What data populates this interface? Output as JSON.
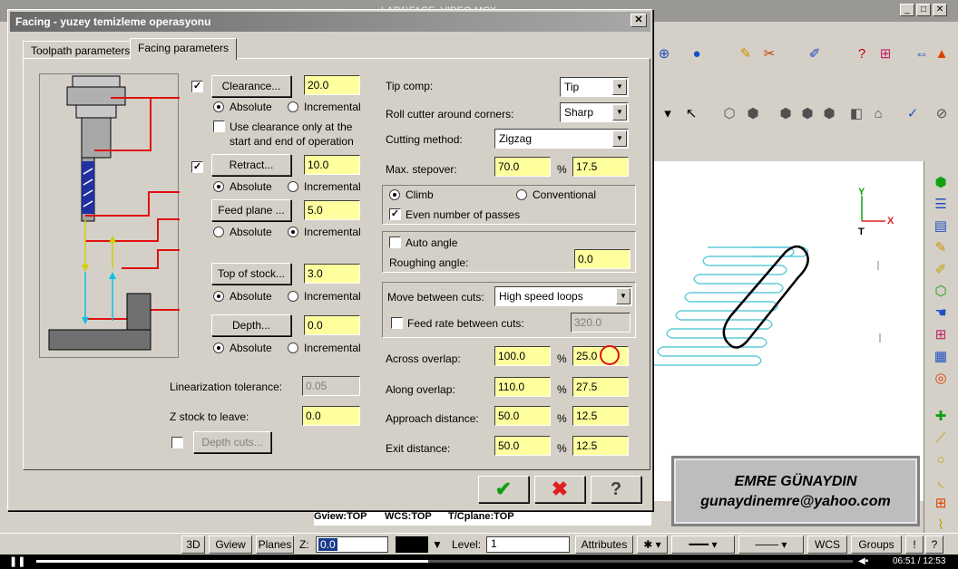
{
  "app": {
    "title_fragment": "                                                                                    LAR1\\FACE_VIDEO.MCX"
  },
  "dialog": {
    "title": "Facing - yuzey temizleme operasyonu",
    "tabs": [
      "Toolpath parameters",
      "Facing parameters"
    ],
    "clearance": {
      "label": "Clearance...",
      "value": "20.0",
      "checked": true,
      "mode": "Absolute",
      "note": "Use clearance only at the start and end of operation"
    },
    "retract": {
      "label": "Retract...",
      "value": "10.0",
      "checked": true,
      "mode": "Absolute"
    },
    "feed_plane": {
      "label": "Feed plane ...",
      "value": "5.0",
      "mode": "Incremental"
    },
    "top_of_stock": {
      "label": "Top of stock...",
      "value": "3.0",
      "mode": "Absolute"
    },
    "depth": {
      "label": "Depth...",
      "value": "0.0",
      "mode": "Absolute"
    },
    "radio_labels": {
      "absolute": "Absolute",
      "incremental": "Incremental"
    },
    "linearization": {
      "label": "Linearization tolerance:",
      "value": "0.05"
    },
    "z_stock": {
      "label": "Z stock to leave:",
      "value": "0.0"
    },
    "depth_cuts": {
      "label": "Depth cuts..."
    },
    "tip_comp": {
      "label": "Tip comp:",
      "value": "Tip"
    },
    "roll_cutter": {
      "label": "Roll cutter around corners:",
      "value": "Sharp"
    },
    "cutting_method": {
      "label": "Cutting method:",
      "value": "Zigzag"
    },
    "max_stepover": {
      "label": "Max. stepover:",
      "percent": "70.0",
      "value": "17.5"
    },
    "climb": "Climb",
    "conventional": "Conventional",
    "even_passes": "Even number of passes",
    "auto_angle": "Auto angle",
    "roughing_angle": {
      "label": "Roughing angle:",
      "value": "0.0"
    },
    "move_between": {
      "label": "Move between cuts:",
      "value": "High speed loops"
    },
    "feed_between": {
      "label": "Feed rate between cuts:",
      "value": "320.0"
    },
    "across_overlap": {
      "label": "Across overlap:",
      "percent": "100.0",
      "value": "25.0"
    },
    "along_overlap": {
      "label": "Along overlap:",
      "percent": "110.0",
      "value": "27.5"
    },
    "approach": {
      "label": "Approach distance:",
      "percent": "50.0",
      "value": "12.5"
    },
    "exit": {
      "label": "Exit distance:",
      "percent": "50.0",
      "value": "12.5"
    },
    "pct": "%"
  },
  "graphics": {
    "gview": "Gview:TOP",
    "wcs": "WCS:TOP",
    "tcplane": "T/Cplane:TOP",
    "axis_y": "Y",
    "axis_x": "X",
    "axis_t": "T"
  },
  "signature": {
    "name": "EMRE GÜNAYDIN",
    "email": "gunaydinemre@yahoo.com"
  },
  "status": {
    "b3d": "3D",
    "gview": "Gview",
    "planes": "Planes",
    "z_label": "Z:",
    "z_value": "0.0",
    "level_label": "Level:",
    "level_value": "1",
    "attributes": "Attributes",
    "wcs": "WCS",
    "groups": "Groups",
    "bang": "!",
    "help": "?"
  },
  "player": {
    "time": "06:51 / 12:53",
    "progress": 0.48
  }
}
